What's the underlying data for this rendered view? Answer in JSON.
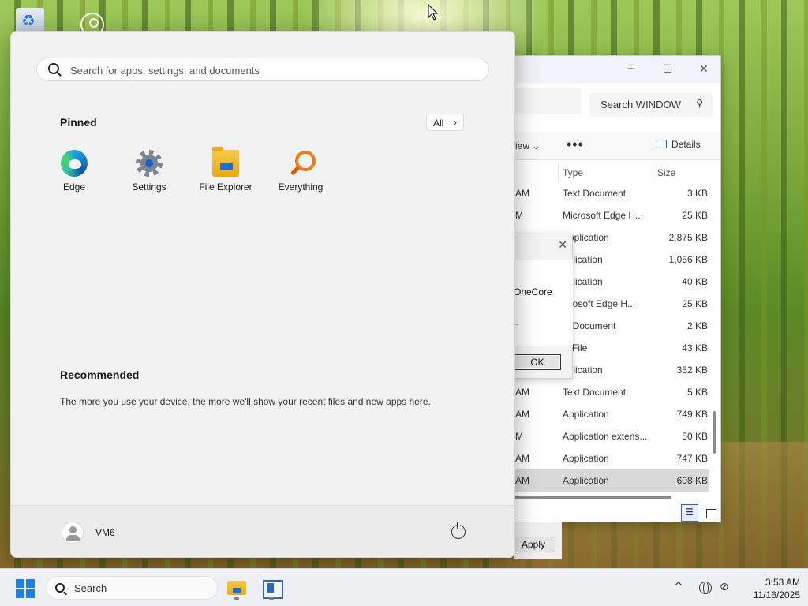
{
  "start_menu": {
    "search_placeholder": "Search for apps, settings, and documents",
    "pinned_label": "Pinned",
    "all_label": "All",
    "pinned_apps": [
      {
        "label": "Edge",
        "icon": "edge-icon"
      },
      {
        "label": "Settings",
        "icon": "settings-icon"
      },
      {
        "label": "File Explorer",
        "icon": "folder-icon"
      },
      {
        "label": "Everything",
        "icon": "magnifier-icon"
      }
    ],
    "recommended_label": "Recommended",
    "recommended_text": "The more you use your device, the more we'll show your recent files and new apps here.",
    "user_name": "VM6"
  },
  "explorer": {
    "search_text": "Search WINDOW",
    "view_label": "iew",
    "details_label": "Details",
    "columns": {
      "type": "Type",
      "size": "Size"
    },
    "rows": [
      {
        "am": "AM",
        "type": "Text Document",
        "size": "3 KB"
      },
      {
        "am": "M",
        "type": "Microsoft Edge H...",
        "size": "25 KB"
      },
      {
        "am": "",
        "type": "Application",
        "size": "2,875 KB"
      },
      {
        "am": "",
        "type": "pplication",
        "size": "1,056 KB"
      },
      {
        "am": "",
        "type": "pplication",
        "size": "40 KB"
      },
      {
        "am": "",
        "type": "icrosoft Edge H...",
        "size": "25 KB"
      },
      {
        "am": "",
        "type": "xt Document",
        "size": "2 KB"
      },
      {
        "am": "",
        "type": "N File",
        "size": "43 KB"
      },
      {
        "am": "",
        "type": "pplication",
        "size": "352 KB"
      },
      {
        "am": "AM",
        "type": "Text Document",
        "size": "5 KB"
      },
      {
        "am": "AM",
        "type": "Application",
        "size": "749 KB"
      },
      {
        "am": "M",
        "type": "Application extens...",
        "size": "50 KB"
      },
      {
        "am": "AM",
        "type": "Application",
        "size": "747 KB"
      },
      {
        "am": "AM",
        "type": "Application",
        "size": "608 KB",
        "selected": true
      }
    ]
  },
  "dialog": {
    "text": "OneCore",
    "dash": "-",
    "ok_label": "OK"
  },
  "apply_label": "Apply",
  "taskbar": {
    "search_label": "Search",
    "time": "3:53 AM",
    "date": "11/16/2025"
  },
  "colors": {
    "accent": "#1f7fe3",
    "start_bg": "#f2f2f2",
    "taskbar_bg": "#eef0f4"
  }
}
